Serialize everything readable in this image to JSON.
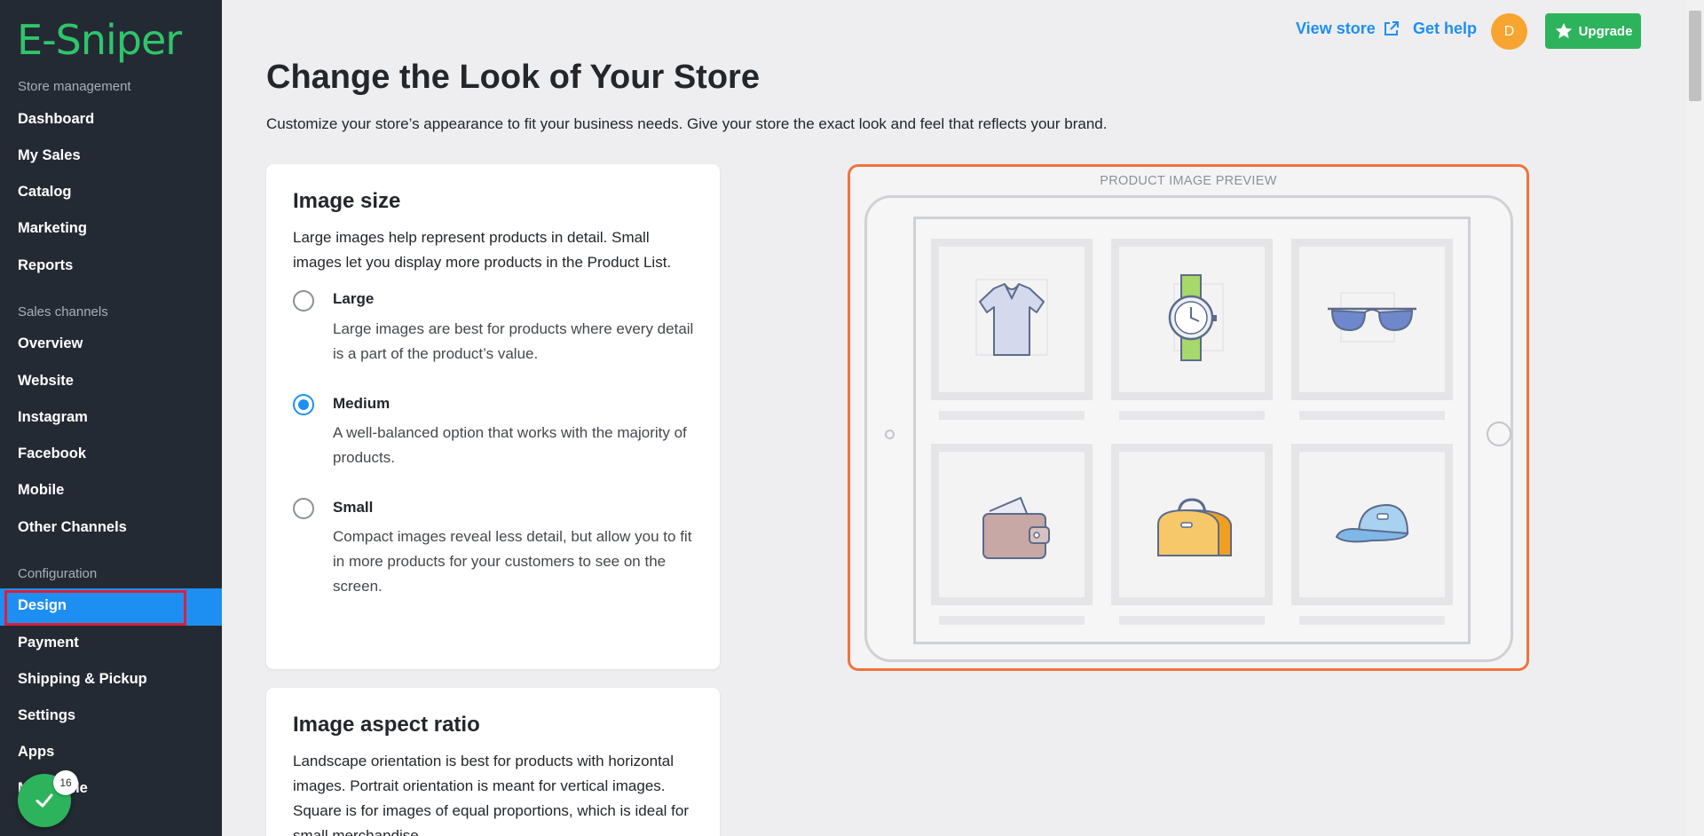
{
  "app": {
    "logo": "E-Sniper"
  },
  "sidebar": {
    "sections": {
      "store_management": "Store management",
      "sales_channels": "Sales channels",
      "configuration": "Configuration"
    },
    "items": [
      {
        "label": "Dashboard"
      },
      {
        "label": "My Sales"
      },
      {
        "label": "Catalog"
      },
      {
        "label": "Marketing"
      },
      {
        "label": "Reports"
      },
      {
        "label": "Overview"
      },
      {
        "label": "Website"
      },
      {
        "label": "Instagram"
      },
      {
        "label": "Facebook"
      },
      {
        "label": "Mobile"
      },
      {
        "label": "Other Channels"
      },
      {
        "label": "Design",
        "active": true
      },
      {
        "label": "Payment"
      },
      {
        "label": "Shipping & Pickup"
      },
      {
        "label": "Settings"
      },
      {
        "label": "Apps"
      },
      {
        "label": "My Profile"
      }
    ],
    "fab_badge": "16"
  },
  "topbar": {
    "view_store": "View store",
    "get_help": "Get help",
    "avatar_initial": "D",
    "upgrade": "Upgrade"
  },
  "main": {
    "title": "Change the Look of Your Store",
    "description": "Customize your store’s appearance to fit your business needs. Give your store the exact look and feel that reflects your brand.",
    "image_size": {
      "title": "Image size",
      "description": "Large images help represent products in detail. Small images let you display more products in the Product List.",
      "options": [
        {
          "label": "Large",
          "description": "Large images are best for products where every detail is a part of the product’s value.",
          "checked": false
        },
        {
          "label": "Medium",
          "description": "A well-balanced option that works with the majority of products.",
          "checked": true
        },
        {
          "label": "Small",
          "description": "Compact images reveal less detail, but allow you to fit in more products for your customers to see on the screen.",
          "checked": false
        }
      ]
    },
    "aspect_ratio": {
      "title": "Image aspect ratio",
      "description": "Landscape orientation is best for products with horizontal images. Portrait orientation is meant for vertical images. Square is for images of equal proportions, which is ideal for small merchandise."
    },
    "preview": {
      "label": "PRODUCT IMAGE PREVIEW",
      "products": [
        "t-shirt-icon",
        "watch-icon",
        "sunglasses-icon",
        "wallet-icon",
        "bag-icon",
        "cap-icon"
      ]
    }
  },
  "colors": {
    "sidebar_bg": "#242a33",
    "accent": "#1e8ff2",
    "brand_green": "#2fc56b",
    "preview_border": "#f0733d",
    "avatar": "#f7a530"
  }
}
